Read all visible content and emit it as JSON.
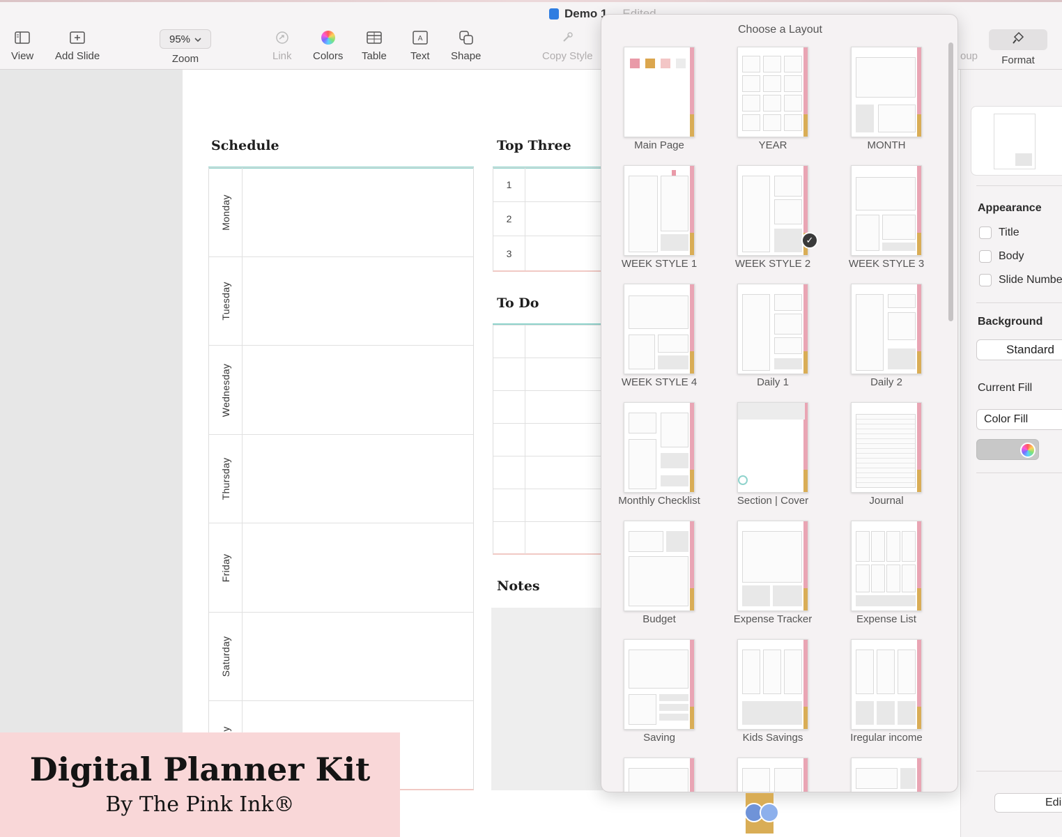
{
  "window": {
    "title": "Demo 1",
    "status": "Edited"
  },
  "toolbar": {
    "view": "View",
    "add_slide": "Add Slide",
    "zoom_value": "95%",
    "zoom": "Zoom",
    "link": "Link",
    "colors": "Colors",
    "table": "Table",
    "text": "Text",
    "shape": "Shape",
    "copy_style": "Copy Style",
    "group": "oup",
    "format": "Format"
  },
  "slide": {
    "schedule_title": "Schedule",
    "days": [
      "Monday",
      "Tuesday",
      "Wednesday",
      "Thursday",
      "Friday",
      "Saturday",
      "y"
    ],
    "top_three_title": "Top Three",
    "top_three_numbers": [
      "1",
      "2",
      "3"
    ],
    "todo_title": "To Do",
    "notes_title": "Notes"
  },
  "popover": {
    "title": "Choose a Layout",
    "layouts": [
      "Main Page",
      "YEAR",
      "MONTH",
      "WEEK STYLE 1",
      "WEEK STYLE 2",
      "WEEK STYLE 3",
      "WEEK STYLE 4",
      "Daily 1",
      "Daily 2",
      "Monthly Checklist",
      "Section | Cover",
      "Journal",
      "Budget",
      "Expense Tracker",
      "Expense List",
      "Saving",
      "Kids Savings",
      "Iregular income",
      "",
      "",
      ""
    ],
    "selected": "WEEK STYLE 2"
  },
  "inspector": {
    "appearance": "Appearance",
    "title_check": "Title",
    "body_check": "Body",
    "slide_number_check": "Slide Numbe",
    "background": "Background",
    "standard": "Standard",
    "current_fill": "Current Fill",
    "color_fill": "Color Fill",
    "edit": "Edi"
  },
  "brand": {
    "title": "Digital Planner Kit",
    "subtitle": "By The Pink Ink®"
  },
  "colors": {
    "accent_teal": "#8fd3cc",
    "accent_pink": "#f1c9c4",
    "brand_bg": "#f9d7d8",
    "tab_pink": "#e9a5b4",
    "tab_gold": "#d9ad56"
  }
}
